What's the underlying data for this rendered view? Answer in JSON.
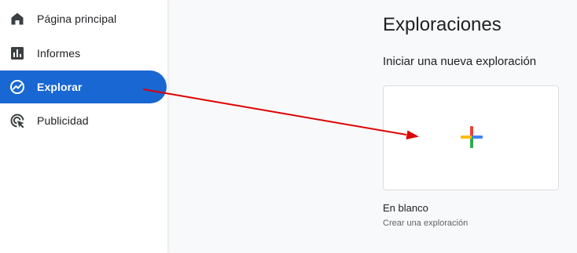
{
  "sidebar": {
    "items": [
      {
        "label": "Página principal",
        "icon": "home-icon"
      },
      {
        "label": "Informes",
        "icon": "reports-bar-chart-icon"
      },
      {
        "label": "Explorar",
        "icon": "explore-trend-icon",
        "active": true
      },
      {
        "label": "Publicidad",
        "icon": "advertising-cursor-icon"
      }
    ]
  },
  "main": {
    "title": "Exploraciones",
    "subtitle": "Iniciar una nueva exploración",
    "cards": [
      {
        "title": "En blanco",
        "description": "Crear una exploración",
        "icon": "plus-icon"
      }
    ]
  },
  "colors": {
    "active_nav_bg": "#1967d2",
    "annotation_arrow": "#e00000",
    "plus_red": "#ea4335",
    "plus_blue": "#4285f4",
    "plus_green": "#34a853",
    "plus_yellow": "#fbbc04"
  }
}
